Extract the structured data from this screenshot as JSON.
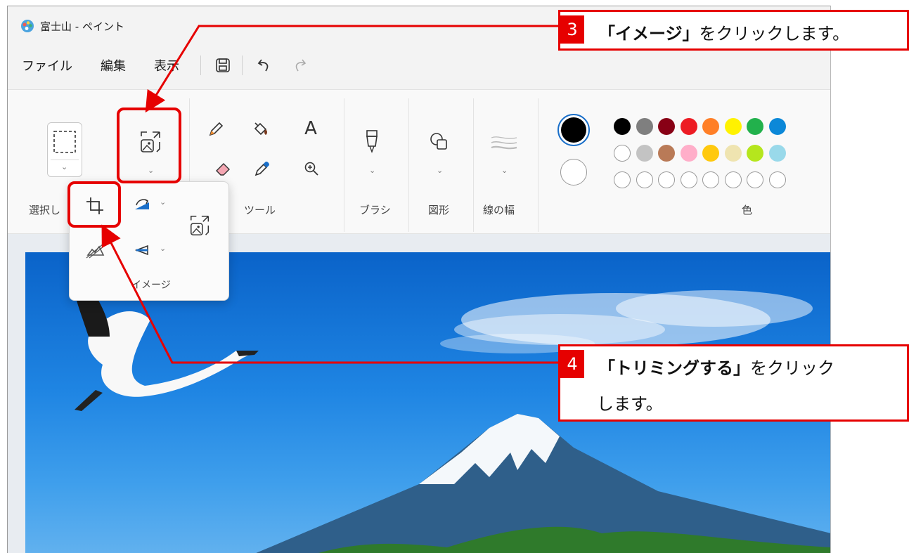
{
  "window": {
    "title": "富士山 - ペイント"
  },
  "menu": {
    "file": "ファイル",
    "edit": "編集",
    "view": "表示"
  },
  "ribbon": {
    "selection_label": "選択し",
    "tools_label": "ツール",
    "brush_label": "ブラシ",
    "shapes_label": "図形",
    "line_width_label": "線の幅",
    "colors_label": "色"
  },
  "popup": {
    "label": "イメージ"
  },
  "colors": {
    "row1": [
      "#000000",
      "#7f7f7f",
      "#880015",
      "#ed1c24",
      "#ff7f27",
      "#fff200",
      "#22b14c",
      "#0c88d8"
    ],
    "row2": [
      "#ffffff",
      "#c3c3c3",
      "#b97a57",
      "#ffaec9",
      "#ffc90e",
      "#efe4b0",
      "#b5e61d",
      "#99d9ea"
    ],
    "accent_red": "#e60000"
  },
  "callouts": [
    {
      "number": "3",
      "bold": "「イメージ」",
      "rest": "をクリックします。"
    },
    {
      "number": "4",
      "bold": "「トリミングする」",
      "rest": "をクリック",
      "line2": "します。"
    }
  ]
}
